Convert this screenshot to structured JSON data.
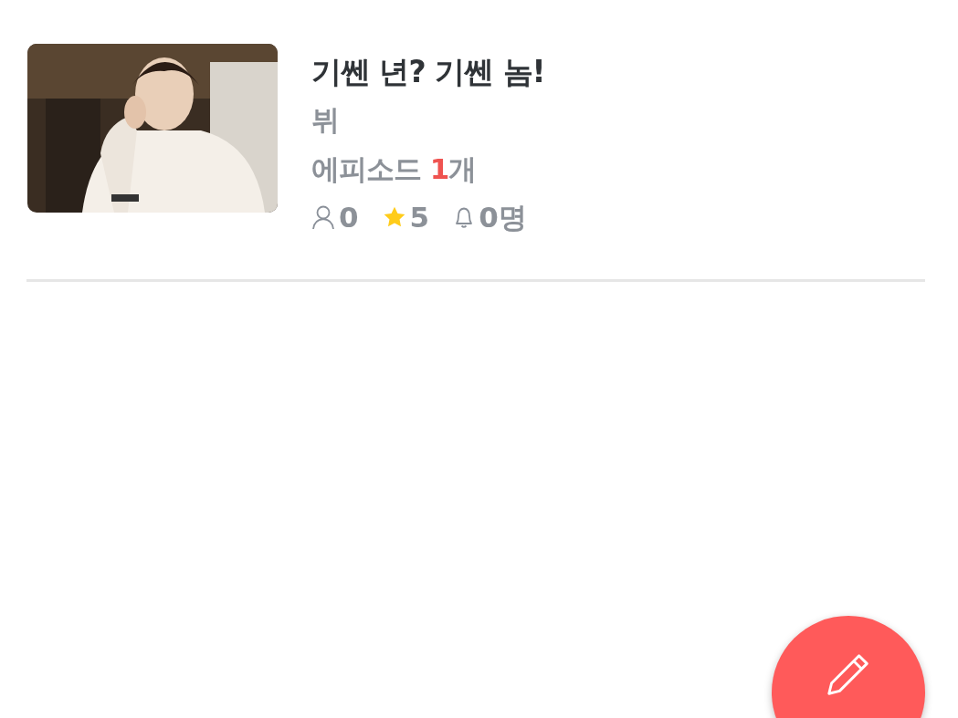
{
  "story": {
    "title": "기쎈 년? 기쎈 놈!",
    "author": "뷔",
    "episodes": {
      "label": "에피소드",
      "count": "1",
      "unit": "개"
    },
    "stats": [
      {
        "kind": "readers",
        "value": "0"
      },
      {
        "kind": "rating",
        "value": "5"
      },
      {
        "kind": "subscribers",
        "value": "0명"
      }
    ]
  },
  "fab": {
    "kind": "write"
  }
}
